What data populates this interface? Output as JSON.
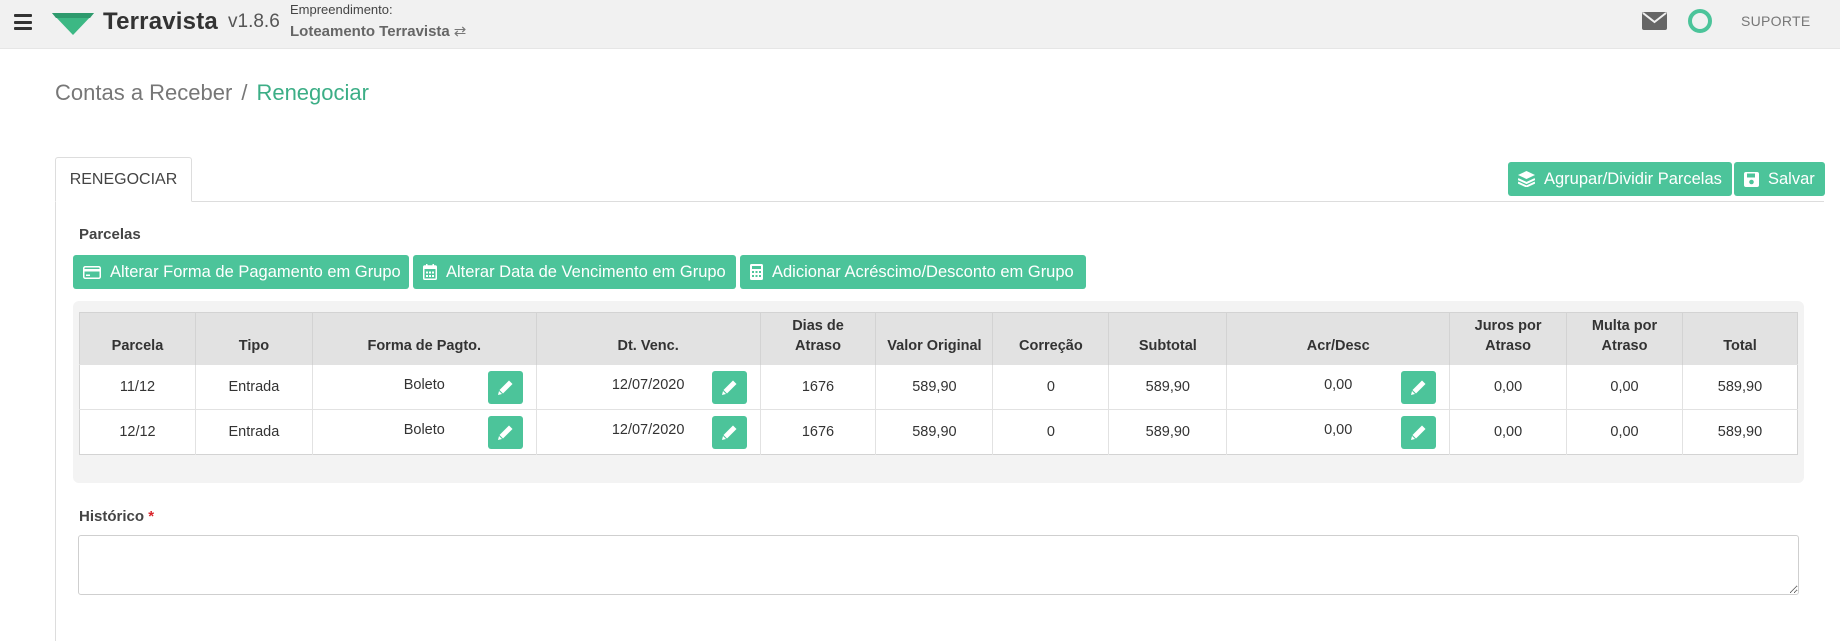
{
  "header": {
    "brand": "Terravista",
    "version": "v1.8.6",
    "empreendimento_label": "Empreendimento:",
    "empreendimento_value": "Loteamento Terravista",
    "swap_glyph": "⇄",
    "support_label": "SUPORTE",
    "accent_color": "#4cc49a"
  },
  "breadcrumb": {
    "parent": "Contas a Receber",
    "separator": "/",
    "current": "Renegociar"
  },
  "tabs": [
    {
      "label": "RENEGOCIAR",
      "active": true
    }
  ],
  "actions": {
    "group_split": "Agrupar/Dividir Parcelas",
    "save": "Salvar"
  },
  "parcelas": {
    "label": "Parcelas",
    "group_buttons": [
      {
        "label": "Alterar Forma de Pagamento em Grupo",
        "icon": "credit-card-icon"
      },
      {
        "label": "Alterar Data de Vencimento em Grupo",
        "icon": "calendar-icon"
      },
      {
        "label": "Adicionar Acréscimo/Desconto em Grupo",
        "icon": "calculator-icon"
      }
    ],
    "columns": [
      {
        "line1": "",
        "line2": "Parcela"
      },
      {
        "line1": "",
        "line2": "Tipo"
      },
      {
        "line1": "",
        "line2": "Forma de Pagto."
      },
      {
        "line1": "",
        "line2": "Dt. Venc."
      },
      {
        "line1": "Dias de",
        "line2": "Atraso"
      },
      {
        "line1": "",
        "line2": "Valor Original"
      },
      {
        "line1": "",
        "line2": "Correção"
      },
      {
        "line1": "",
        "line2": "Subtotal"
      },
      {
        "line1": "",
        "line2": "Acr/Desc"
      },
      {
        "line1": "Juros por",
        "line2": "Atraso"
      },
      {
        "line1": "Multa por",
        "line2": "Atraso"
      },
      {
        "line1": "",
        "line2": "Total"
      }
    ],
    "rows": [
      {
        "parcela": "11/12",
        "tipo": "Entrada",
        "forma": "Boleto",
        "vencimento": "12/07/2020",
        "dias_atraso": "1676",
        "valor_original": "589,90",
        "correcao": "0",
        "subtotal": "589,90",
        "acr_desc": "0,00",
        "juros": "0,00",
        "multa": "0,00",
        "total": "589,90"
      },
      {
        "parcela": "12/12",
        "tipo": "Entrada",
        "forma": "Boleto",
        "vencimento": "12/07/2020",
        "dias_atraso": "1676",
        "valor_original": "589,90",
        "correcao": "0",
        "subtotal": "589,90",
        "acr_desc": "0,00",
        "juros": "0,00",
        "multa": "0,00",
        "total": "589,90"
      }
    ]
  },
  "historico": {
    "label": "Histórico",
    "required_mark": "*",
    "value": ""
  }
}
